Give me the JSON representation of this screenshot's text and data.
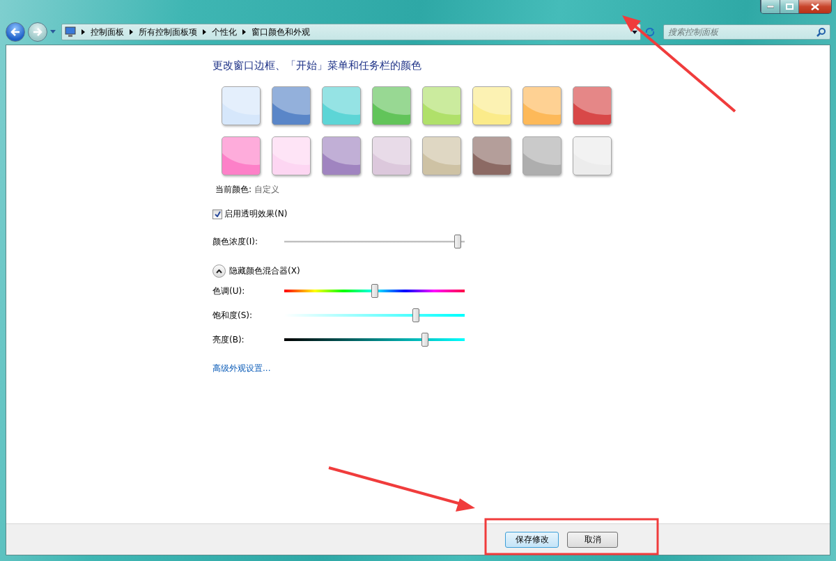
{
  "address_bar": {
    "breadcrumb": [
      "控制面板",
      "所有控制面板项",
      "个性化",
      "窗口颜色和外观"
    ]
  },
  "search": {
    "placeholder": "搜索控制面板"
  },
  "heading": "更改窗口边框、「开始」菜单和任务栏的颜色",
  "swatches": [
    {
      "color": "#d6e7fb"
    },
    {
      "color": "#5a86c8"
    },
    {
      "color": "#5dd5d6"
    },
    {
      "color": "#62c45a"
    },
    {
      "color": "#b0e06a"
    },
    {
      "color": "#fbeb8a"
    },
    {
      "color": "#fdb959"
    },
    {
      "color": "#d84848"
    },
    {
      "color": "#fd80c8"
    },
    {
      "color": "#fdd6f2"
    },
    {
      "color": "#a084c0"
    },
    {
      "color": "#dcc8dc"
    },
    {
      "color": "#cec2a4"
    },
    {
      "color": "#8c6a64"
    },
    {
      "color": "#aeaeae"
    },
    {
      "color": "#ececec"
    }
  ],
  "current_color": {
    "label": "当前颜色:",
    "value": "自定义"
  },
  "transparency": {
    "label": "启用透明效果(N)",
    "checked": true
  },
  "intensity": {
    "label": "颜色浓度(I):",
    "level": 0.98
  },
  "mixer": {
    "label": "隐藏颜色混合器(X)",
    "expanded": true
  },
  "mixer_sliders": [
    {
      "kind": "hue",
      "label": "色调(U):",
      "level": 0.5
    },
    {
      "kind": "saturation",
      "label": "饱和度(S):",
      "level": 0.74
    },
    {
      "kind": "brightness",
      "label": "亮度(B):",
      "level": 0.79
    }
  ],
  "advanced_link": "高级外观设置...",
  "buttons": [
    {
      "label": "保存修改",
      "default": true
    },
    {
      "label": "取消",
      "default": false
    }
  ]
}
